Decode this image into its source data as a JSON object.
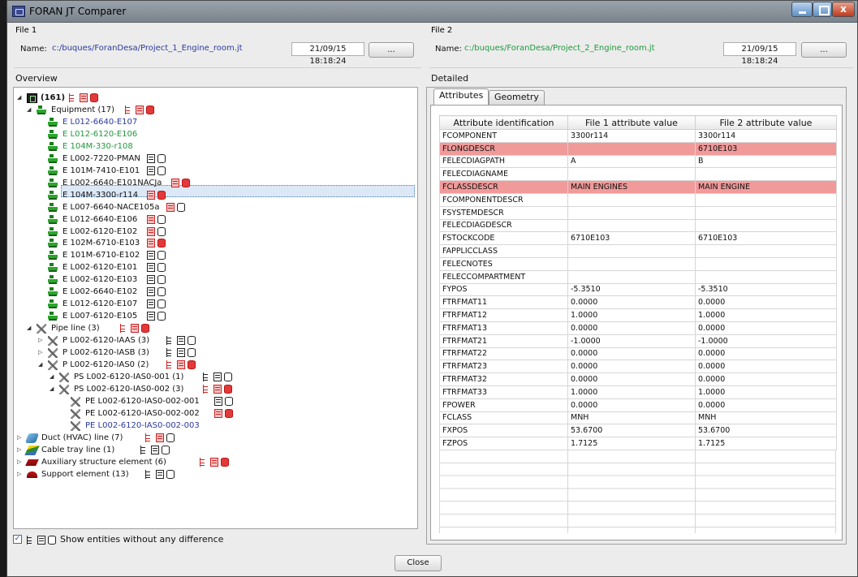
{
  "window": {
    "title": "FORAN JT Comparer"
  },
  "file1": {
    "group_label": "File 1",
    "name_label": "Name:",
    "path": "c:/buques/ForanDesa/Project_1_Engine_room.jt",
    "path_color": "#2a3a9e",
    "date": "21/09/15 18:18:24",
    "browse_label": "..."
  },
  "file2": {
    "group_label": "File 2",
    "name_label": "Name:",
    "path": "c:/buques/ForanDesa/Project_2_Engine_room.jt",
    "path_color": "#1f9a3c",
    "date": "21/09/15 18:18:24",
    "browse_label": "..."
  },
  "overview": {
    "title": "Overview",
    "root_label": "(161)",
    "nodes": [
      {
        "label": "Equipment (17)",
        "icon": "equipment-icon"
      },
      {
        "label": "E L012-6640-E107",
        "color": "#2a3a9e"
      },
      {
        "label": "E L012-6120-E106",
        "color": "#1f9a3c"
      },
      {
        "label": "E 104M-330-r108",
        "color": "#1f9a3c"
      },
      {
        "label": "E L002-7220-PMAN"
      },
      {
        "label": "E 101M-7410-E101"
      },
      {
        "label": "E L002-6640-E101NACJa"
      },
      {
        "label": "E 104M-3300-r114"
      },
      {
        "label": "E L007-6640-NACE105a"
      },
      {
        "label": "E L012-6640-E106"
      },
      {
        "label": "E L002-6120-E102"
      },
      {
        "label": "E 102M-6710-E103"
      },
      {
        "label": "E 101M-6710-E102"
      },
      {
        "label": "E L002-6120-E101"
      },
      {
        "label": "E L002-6120-E103"
      },
      {
        "label": "E L002-6640-E102"
      },
      {
        "label": "E L012-6120-E107"
      },
      {
        "label": "E L007-6120-E105"
      },
      {
        "label": "Pipe line (3)",
        "icon": "pipe-icon"
      },
      {
        "label": "P L002-6120-IAAS (3)"
      },
      {
        "label": "P L002-6120-IASB (3)"
      },
      {
        "label": "P L002-6120-IAS0 (2)"
      },
      {
        "label": "PS L002-6120-IAS0-001 (1)"
      },
      {
        "label": "PS L002-6120-IAS0-002 (3)"
      },
      {
        "label": "PE L002-6120-IAS0-002-001"
      },
      {
        "label": "PE L002-6120-IAS0-002-002"
      },
      {
        "label": "PE L002-6120-IAS0-002-003",
        "color": "#2a3a9e"
      },
      {
        "label": "Duct (HVAC) line (7)",
        "icon": "duct-icon"
      },
      {
        "label": "Cable tray line (1)",
        "icon": "cable-tray-icon"
      },
      {
        "label": "Auxiliary structure element (6)",
        "icon": "auxiliary-structure-icon"
      },
      {
        "label": "Support element (13)",
        "icon": "support-element-icon"
      }
    ],
    "show_without_difference_label": "Show entities without any difference",
    "show_without_difference_checked": true
  },
  "detailed": {
    "title": "Detailed",
    "tabs": [
      "Attributes",
      "Geometry"
    ],
    "active_tab": "Attributes",
    "columns": [
      "Attribute identification",
      "File 1 attribute value",
      "File 2 attribute value"
    ],
    "rows": [
      {
        "id": "FCOMPONENT",
        "v1": "3300r114",
        "v2": "3300r114"
      },
      {
        "id": "FLONGDESCR",
        "v1": "",
        "v2": "6710E103",
        "diff": true
      },
      {
        "id": "FELECDIAGPATH",
        "v1": "A",
        "v2": "B"
      },
      {
        "id": "FELECDIAGNAME",
        "v1": "",
        "v2": ""
      },
      {
        "id": "FCLASSDESCR",
        "v1": "MAIN ENGINES",
        "v2": "MAIN ENGINE",
        "diff": true
      },
      {
        "id": "FCOMPONENTDESCR",
        "v1": "",
        "v2": ""
      },
      {
        "id": "FSYSTEMDESCR",
        "v1": "",
        "v2": ""
      },
      {
        "id": "FELECDIAGDESCR",
        "v1": "",
        "v2": ""
      },
      {
        "id": "FSTOCKCODE",
        "v1": "6710E103",
        "v2": "6710E103"
      },
      {
        "id": "FAPPLICCLASS",
        "v1": "",
        "v2": ""
      },
      {
        "id": "FELECNOTES",
        "v1": "",
        "v2": ""
      },
      {
        "id": "FELECCOMPARTMENT",
        "v1": "",
        "v2": ""
      },
      {
        "id": "FYPOS",
        "v1": "-5.3510",
        "v2": "-5.3510"
      },
      {
        "id": "FTRFMAT11",
        "v1": "0.0000",
        "v2": "0.0000"
      },
      {
        "id": "FTRFMAT12",
        "v1": "1.0000",
        "v2": "1.0000"
      },
      {
        "id": "FTRFMAT13",
        "v1": "0.0000",
        "v2": "0.0000"
      },
      {
        "id": "FTRFMAT21",
        "v1": "-1.0000",
        "v2": "-1.0000"
      },
      {
        "id": "FTRFMAT22",
        "v1": "0.0000",
        "v2": "0.0000"
      },
      {
        "id": "FTRFMAT23",
        "v1": "0.0000",
        "v2": "0.0000"
      },
      {
        "id": "FTRFMAT32",
        "v1": "0.0000",
        "v2": "0.0000"
      },
      {
        "id": "FTRFMAT33",
        "v1": "1.0000",
        "v2": "1.0000"
      },
      {
        "id": "FPOWER",
        "v1": "0.0000",
        "v2": "0.0000"
      },
      {
        "id": "FCLASS",
        "v1": "MNH",
        "v2": "MNH"
      },
      {
        "id": "FXPOS",
        "v1": "53.6700",
        "v2": "53.6700"
      },
      {
        "id": "FZPOS",
        "v1": "1.7125",
        "v2": "1.7125"
      }
    ],
    "diff_color": "#f19a9a"
  },
  "footer": {
    "close_label": "Close"
  }
}
